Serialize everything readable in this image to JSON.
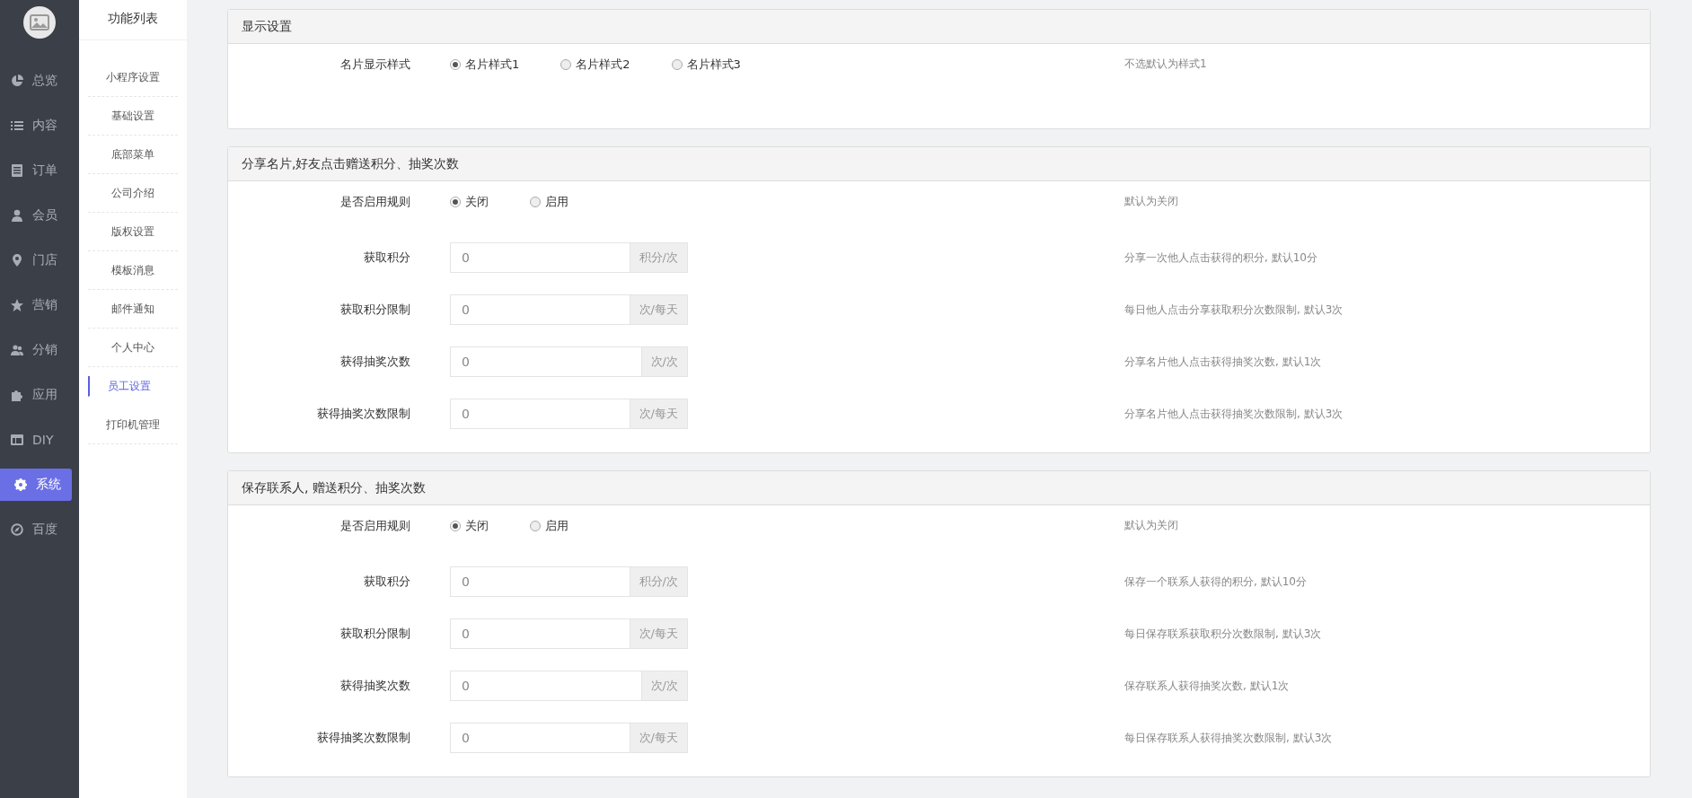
{
  "nav": {
    "items": [
      {
        "label": "总览",
        "selected": false
      },
      {
        "label": "内容",
        "selected": false
      },
      {
        "label": "订单",
        "selected": false
      },
      {
        "label": "会员",
        "selected": false
      },
      {
        "label": "门店",
        "selected": false
      },
      {
        "label": "营销",
        "selected": false
      },
      {
        "label": "分销",
        "selected": false
      },
      {
        "label": "应用",
        "selected": false
      },
      {
        "label": "DIY",
        "selected": false
      },
      {
        "label": "系统",
        "selected": true
      },
      {
        "label": "百度",
        "selected": false
      }
    ]
  },
  "submenu": {
    "title": "功能列表",
    "items": [
      {
        "label": "小程序设置",
        "selected": false
      },
      {
        "label": "基础设置",
        "selected": false
      },
      {
        "label": "底部菜单",
        "selected": false
      },
      {
        "label": "公司介绍",
        "selected": false
      },
      {
        "label": "版权设置",
        "selected": false
      },
      {
        "label": "模板消息",
        "selected": false
      },
      {
        "label": "邮件通知",
        "selected": false
      },
      {
        "label": "个人中心",
        "selected": false
      },
      {
        "label": "员工设置",
        "selected": true
      },
      {
        "label": "打印机管理",
        "selected": false
      }
    ]
  },
  "sections": [
    {
      "title": "显示设置",
      "rows": [
        {
          "kind": "radio",
          "label": "名片显示样式",
          "options": [
            {
              "label": "名片样式1",
              "selected": true
            },
            {
              "label": "名片样式2",
              "selected": false
            },
            {
              "label": "名片样式3",
              "selected": false
            }
          ],
          "hint": "不选默认为样式1"
        }
      ]
    },
    {
      "title": "分享名片,好友点击赠送积分、抽奖次数",
      "rows": [
        {
          "kind": "radio",
          "label": "是否启用规则",
          "options": [
            {
              "label": "关闭",
              "selected": true
            },
            {
              "label": "启用",
              "selected": false
            }
          ],
          "hint": "默认为关闭"
        },
        {
          "kind": "input",
          "label": "获取积分",
          "value": "0",
          "addon": "积分/次",
          "hint": "分享一次他人点击获得的积分, 默认10分"
        },
        {
          "kind": "input",
          "label": "获取积分限制",
          "value": "0",
          "addon": "次/每天",
          "hint": "每日他人点击分享获取积分次数限制, 默认3次"
        },
        {
          "kind": "input",
          "label": "获得抽奖次数",
          "value": "0",
          "addon": "次/次",
          "hint": "分享名片他人点击获得抽奖次数, 默认1次"
        },
        {
          "kind": "input",
          "label": "获得抽奖次数限制",
          "value": "0",
          "addon": "次/每天",
          "hint": "分享名片他人点击获得抽奖次数限制, 默认3次"
        }
      ]
    },
    {
      "title": "保存联系人, 赠送积分、抽奖次数",
      "rows": [
        {
          "kind": "radio",
          "label": "是否启用规则",
          "options": [
            {
              "label": "关闭",
              "selected": true
            },
            {
              "label": "启用",
              "selected": false
            }
          ],
          "hint": "默认为关闭"
        },
        {
          "kind": "input",
          "label": "获取积分",
          "value": "0",
          "addon": "积分/次",
          "hint": "保存一个联系人获得的积分, 默认10分"
        },
        {
          "kind": "input",
          "label": "获取积分限制",
          "value": "0",
          "addon": "次/每天",
          "hint": "每日保存联系获取积分次数限制, 默认3次"
        },
        {
          "kind": "input",
          "label": "获得抽奖次数",
          "value": "0",
          "addon": "次/次",
          "hint": "保存联系人获得抽奖次数, 默认1次"
        },
        {
          "kind": "input",
          "label": "获得抽奖次数限制",
          "value": "0",
          "addon": "次/每天",
          "hint": "每日保存联系人获得抽奖次数限制, 默认3次"
        }
      ]
    }
  ]
}
